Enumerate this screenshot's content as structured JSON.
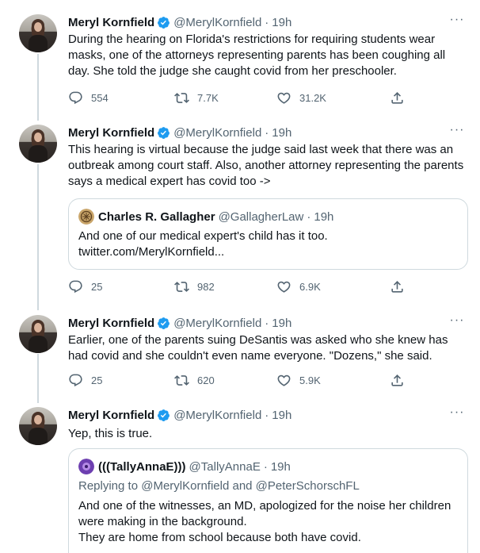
{
  "tweets": [
    {
      "name": "Meryl Kornfield",
      "handle": "@MerylKornfield",
      "time": "19h",
      "text": "During the hearing on Florida's restrictions for requiring students wear masks, one of the attorneys representing parents has been coughing all day. She told the judge she caught covid from her preschooler.",
      "replies": "554",
      "retweets": "7.7K",
      "likes": "31.2K"
    },
    {
      "name": "Meryl Kornfield",
      "handle": "@MerylKornfield",
      "time": "19h",
      "text": "This hearing is virtual because the judge said last week that there was an outbreak among court staff. Also, another attorney representing the parents says a medical expert has covid too ->",
      "quote": {
        "name": "Charles R. Gallagher",
        "handle": "@GallagherLaw",
        "time": "19h",
        "line1": "And one of our medical expert's child has it too.",
        "line2": "twitter.com/MerylKornfield..."
      },
      "replies": "25",
      "retweets": "982",
      "likes": "6.9K"
    },
    {
      "name": "Meryl Kornfield",
      "handle": "@MerylKornfield",
      "time": "19h",
      "text": "Earlier, one of the parents suing DeSantis was asked who she knew has had covid and she couldn't even name everyone. \"Dozens,\" she said.",
      "replies": "25",
      "retweets": "620",
      "likes": "5.9K"
    },
    {
      "name": "Meryl Kornfield",
      "handle": "@MerylKornfield",
      "time": "19h",
      "text": "Yep, this is true.",
      "quote": {
        "name": "(((TallyAnnaE)))",
        "handle": "@TallyAnnaE",
        "time": "19h",
        "replying_label": "Replying to",
        "replying_users": "@MerylKornfield and @PeterSchorschFL",
        "line1": "And one of the witnesses, an MD, apologized for the noise her children were making in the background.",
        "line2": "They are home from school because both have covid."
      }
    }
  ],
  "separator": "·",
  "more_label": "···",
  "icons": {
    "reply": "reply-icon",
    "retweet": "retweet-icon",
    "like": "heart-icon",
    "share": "share-icon",
    "verified": "verified-badge-icon",
    "more": "more-icon"
  },
  "colors": {
    "text": "#0f1419",
    "secondary": "#536471",
    "verified": "#1d9bf0",
    "border": "#cfd9de"
  }
}
